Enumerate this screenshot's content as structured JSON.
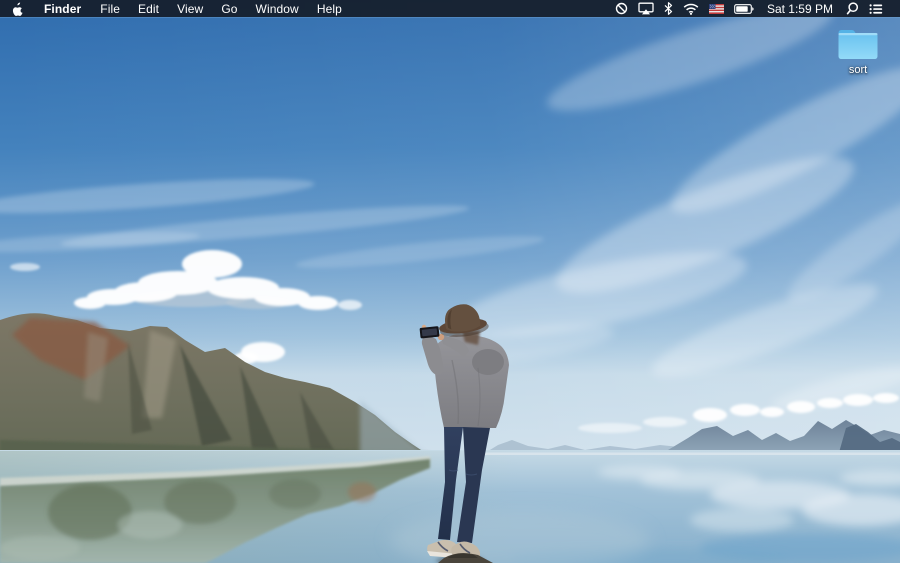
{
  "menu_bar": {
    "apple_icon": "apple-logo",
    "menus": [
      {
        "label": "Finder",
        "bold": true
      },
      {
        "label": "File"
      },
      {
        "label": "Edit"
      },
      {
        "label": "View"
      },
      {
        "label": "Go"
      },
      {
        "label": "Window"
      },
      {
        "label": "Help"
      }
    ],
    "status_icons": [
      {
        "name": "circle-slash-icon"
      },
      {
        "name": "airplay-display-icon"
      },
      {
        "name": "bluetooth-icon"
      },
      {
        "name": "wifi-icon"
      },
      {
        "name": "us-flag-icon"
      },
      {
        "name": "battery-icon"
      }
    ],
    "clock": "Sat 1:59 PM",
    "spotlight_icon": "spotlight-search-icon",
    "notification_icon": "notification-center-icon",
    "colors": {
      "background": "#172130",
      "text": "#ffffff"
    }
  },
  "desktop": {
    "icons": [
      {
        "label": "sort",
        "type": "folder"
      }
    ],
    "folder_color": "#74c9f2",
    "wallpaper": {
      "scene": "Man in a brown hat photographing a mirror-calm mountain lake with his phone",
      "palette": {
        "sky_top": "#2f6cae",
        "sky_horizon": "#c3d9e8",
        "mountain_left": "#75705f",
        "mountain_right": "#7b91a8",
        "water": "#8fb6d2",
        "reflection_green": "#84957c",
        "hat": "#5d4737",
        "sweater": "#8e8e90",
        "jeans": "#2c3a55"
      }
    }
  }
}
